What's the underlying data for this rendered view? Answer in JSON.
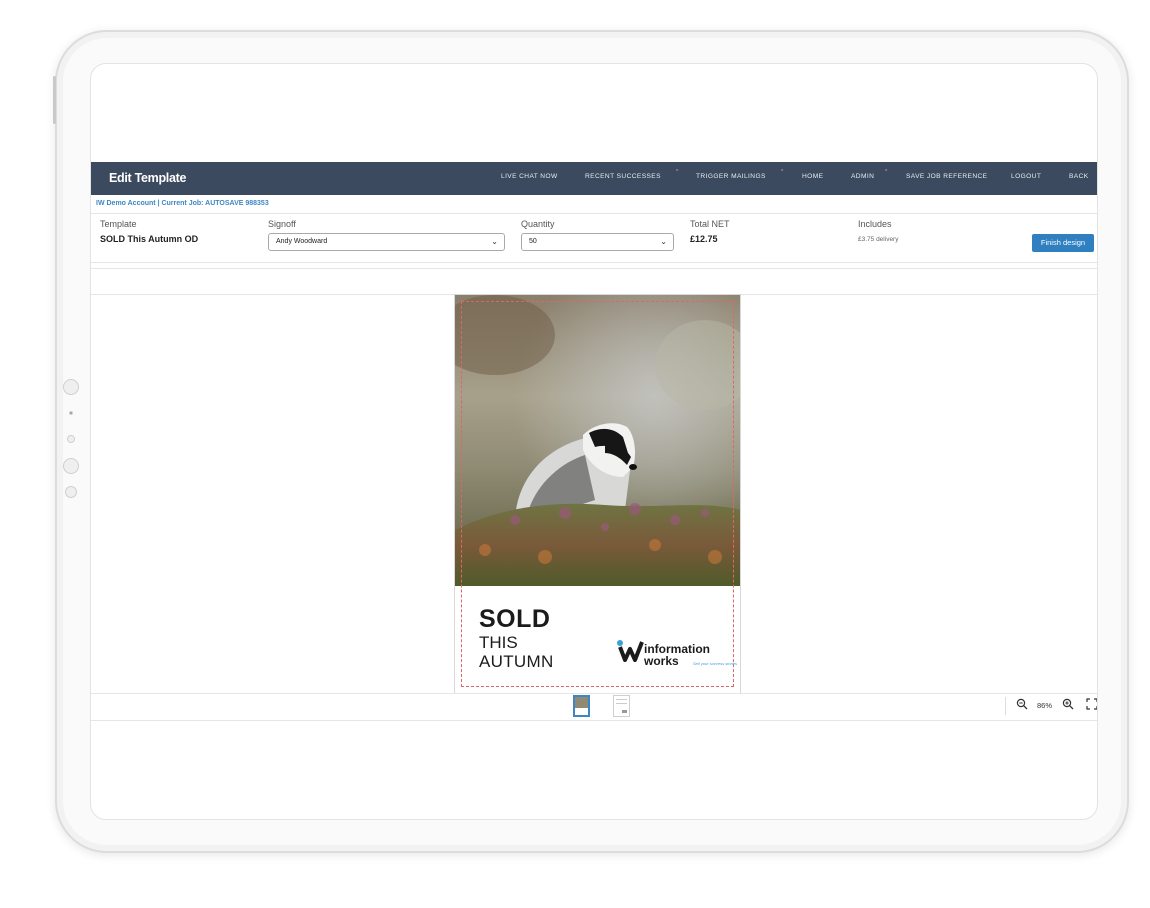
{
  "nav": {
    "title": "Edit Template",
    "items": [
      {
        "label": "LIVE CHAT NOW"
      },
      {
        "label": "RECENT SUCCESSES"
      },
      {
        "label": "TRIGGER MAILINGS"
      },
      {
        "label": "HOME"
      },
      {
        "label": "ADMIN"
      },
      {
        "label": "SAVE JOB REFERENCE"
      },
      {
        "label": "LOGOUT"
      },
      {
        "label": "BACK"
      }
    ]
  },
  "account_line": "IW Demo Account | Current Job: AUTOSAVE 988353",
  "fields": {
    "template": {
      "label": "Template",
      "value": "SOLD This Autumn OD"
    },
    "signoff": {
      "label": "Signoff",
      "value": "Andy Woodward"
    },
    "quantity": {
      "label": "Quantity",
      "value": "50"
    },
    "total": {
      "label": "Total NET",
      "value": "£12.75"
    },
    "includes": {
      "label": "Includes",
      "value": "£3.75 delivery"
    }
  },
  "finish_button": "Finish design",
  "design": {
    "headline": "SOLD",
    "line2": "THIS",
    "line3": "AUTUMN",
    "logo_line1": "information",
    "logo_line2": "works",
    "logo_tagline": "Sell your success stories"
  },
  "zoom": {
    "value": "86%"
  },
  "colors": {
    "navbar": "#3b4a5e",
    "accent": "#2f7fc1",
    "link": "#3d86c6",
    "bleed": "#e06666"
  }
}
